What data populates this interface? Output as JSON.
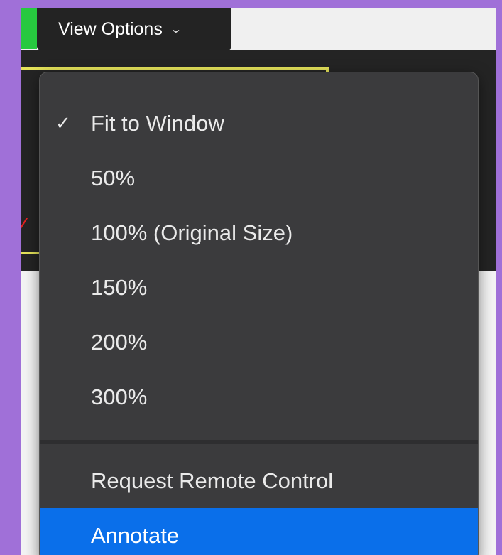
{
  "toolbar": {
    "view_options_label": "View Options",
    "chevron_icon": "chevron-down-icon"
  },
  "menu": {
    "zoom_items": [
      {
        "label": "Fit to Window",
        "checked": true
      },
      {
        "label": "50%",
        "checked": false
      },
      {
        "label": "100% (Original Size)",
        "checked": false
      },
      {
        "label": "150%",
        "checked": false
      },
      {
        "label": "200%",
        "checked": false
      },
      {
        "label": "300%",
        "checked": false
      }
    ],
    "actions": [
      {
        "label": "Request Remote Control"
      },
      {
        "label": "Annotate",
        "highlighted": true
      }
    ],
    "check_glyph": "✓"
  },
  "colors": {
    "accent": "#0a6fea",
    "menu_bg": "#3b3b3d",
    "background": "#a070d8",
    "status_green": "#27c93f",
    "share_border_yellow": "#e5e35a"
  }
}
